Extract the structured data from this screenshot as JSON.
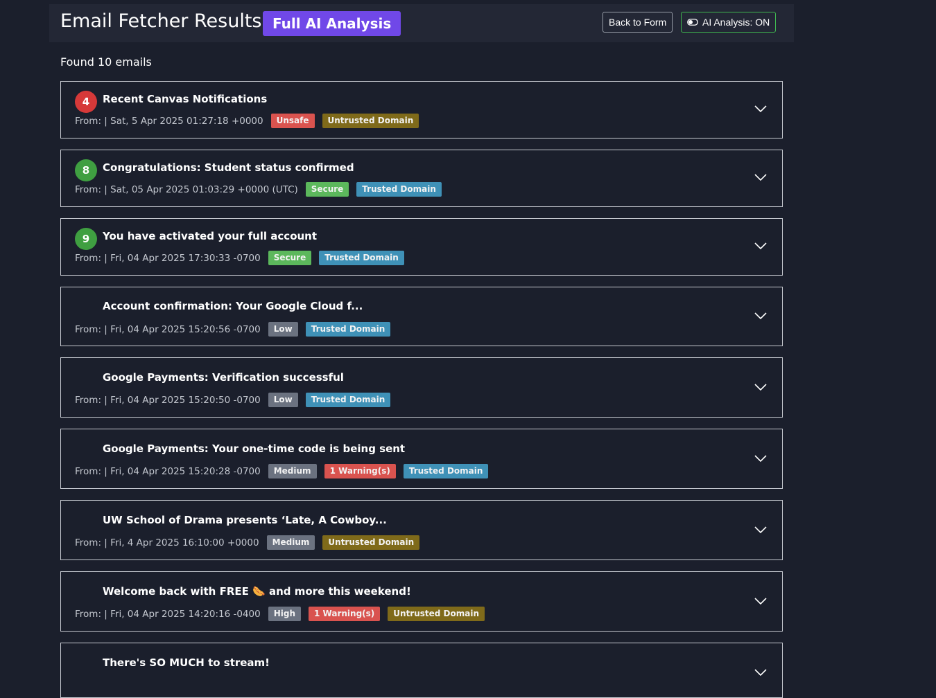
{
  "header": {
    "title": "Email Fetcher Results",
    "badge": "Full AI Analysis",
    "back_label": "Back to Form",
    "ai_toggle_label": "AI Analysis: ON",
    "badge_color": "#7048e8",
    "ai_toggle_color": "#3fb950"
  },
  "summary": "Found 10 emails",
  "colors": {
    "Unsafe": "#d9534f",
    "Secure": "#5cb85c",
    "Untrusted Domain": "#7f6a1a",
    "Trusted Domain": "#3f91b7",
    "Low": "#6b7280",
    "Medium": "#6b7280",
    "High": "#6b7280",
    "Warning": "#d9534f",
    "rank_red": "#d63939",
    "rank_green": "#3f9f41"
  },
  "emails": [
    {
      "rank": "4",
      "rank_color": "#d63939",
      "subject": "Recent Canvas Notifications",
      "from": "From: | Sat, 5 Apr 2025 01:27:18 +0000",
      "badges": [
        {
          "label": "Unsafe",
          "color": "#d9534f"
        },
        {
          "label": "Untrusted Domain",
          "color": "#7f6a1a"
        }
      ]
    },
    {
      "rank": "8",
      "rank_color": "#3f9f41",
      "subject": "Congratulations: Student status confirmed",
      "from": "From: | Sat, 05 Apr 2025 01:03:29 +0000 (UTC)",
      "badges": [
        {
          "label": "Secure",
          "color": "#5cb85c"
        },
        {
          "label": "Trusted Domain",
          "color": "#3f91b7"
        }
      ]
    },
    {
      "rank": "9",
      "rank_color": "#3f9f41",
      "subject": "You have activated your full account",
      "from": "From: | Fri, 04 Apr 2025 17:30:33 -0700",
      "badges": [
        {
          "label": "Secure",
          "color": "#5cb85c"
        },
        {
          "label": "Trusted Domain",
          "color": "#3f91b7"
        }
      ]
    },
    {
      "rank": "",
      "subject": "Account confirmation: Your Google Cloud f...",
      "from": "From: | Fri, 04 Apr 2025 15:20:56 -0700",
      "badges": [
        {
          "label": "Low",
          "color": "#6b7280"
        },
        {
          "label": "Trusted Domain",
          "color": "#3f91b7"
        }
      ]
    },
    {
      "rank": "",
      "subject": "Google Payments: Verification successful",
      "from": "From: | Fri, 04 Apr 2025 15:20:50 -0700",
      "badges": [
        {
          "label": "Low",
          "color": "#6b7280"
        },
        {
          "label": "Trusted Domain",
          "color": "#3f91b7"
        }
      ]
    },
    {
      "rank": "",
      "subject": "Google Payments: Your one-time code is being sent",
      "from": "From: | Fri, 04 Apr 2025 15:20:28 -0700",
      "badges": [
        {
          "label": "Medium",
          "color": "#6b7280"
        },
        {
          "label": "1 Warning(s)",
          "color": "#d9534f"
        },
        {
          "label": "Trusted Domain",
          "color": "#3f91b7"
        }
      ]
    },
    {
      "rank": "",
      "subject": "UW School of Drama presents ‘Late, A Cowboy...",
      "from": "From: | Fri, 4 Apr 2025 16:10:00 +0000",
      "badges": [
        {
          "label": "Medium",
          "color": "#6b7280"
        },
        {
          "label": "Untrusted Domain",
          "color": "#7f6a1a"
        }
      ]
    },
    {
      "rank": "",
      "subject": "Welcome back with FREE 🌭 and more this weekend!",
      "from": "From: | Fri, 04 Apr 2025 14:20:16 -0400",
      "badges": [
        {
          "label": "High",
          "color": "#6b7280"
        },
        {
          "label": "1 Warning(s)",
          "color": "#d9534f"
        },
        {
          "label": "Untrusted Domain",
          "color": "#7f6a1a"
        }
      ]
    },
    {
      "rank": "",
      "subject": "There's SO MUCH to stream!",
      "from": "",
      "badges": []
    }
  ]
}
